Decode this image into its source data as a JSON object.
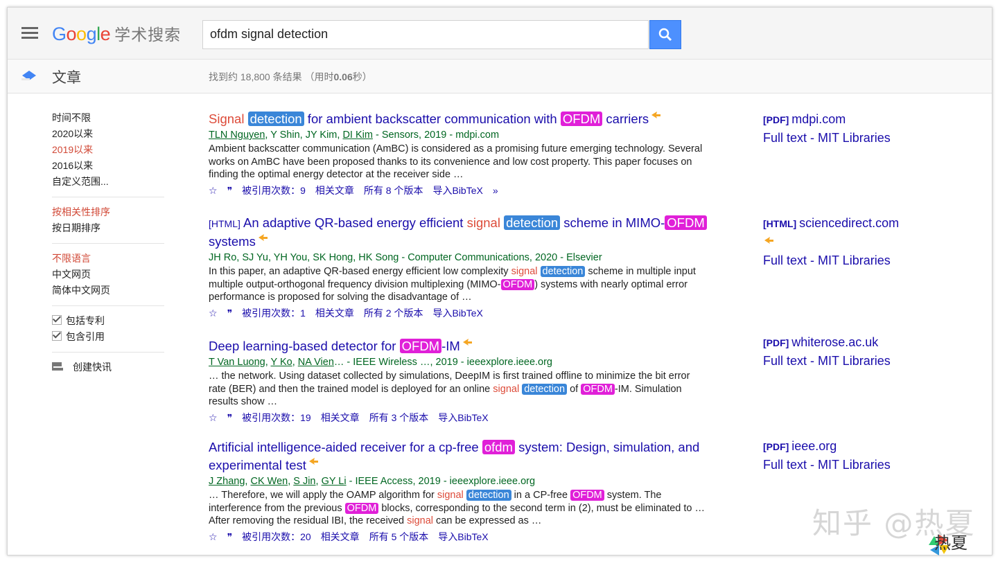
{
  "header": {
    "logo_google": [
      "G",
      "o",
      "o",
      "g",
      "l",
      "e"
    ],
    "logo_suffix": "学术搜索",
    "search_value": "ofdm signal detection"
  },
  "subbar": {
    "section": "文章",
    "stats_prefix": "找到约 18,800 条结果 （用时",
    "stats_time": "0.06",
    "stats_suffix": "秒）"
  },
  "sidebar": {
    "time_filters": [
      "时间不限",
      "2020以来",
      "2019以来",
      "2016以来",
      "自定义范围..."
    ],
    "time_active": "2019以来",
    "sort": [
      "按相关性排序",
      "按日期排序"
    ],
    "lang": [
      "不限语言",
      "中文网页",
      "简体中文网页"
    ],
    "checks": [
      "包括专利",
      "包含引用"
    ],
    "alert": "创建快讯"
  },
  "results": [
    {
      "title_parts": [
        [
          "red",
          "Signal"
        ],
        [
          "plain",
          " "
        ],
        [
          "blue",
          "detection"
        ],
        [
          "plain",
          " for ambient backscatter communication with "
        ],
        [
          "pink",
          "OFDM"
        ],
        [
          "plain",
          " carriers"
        ]
      ],
      "authors_parts": [
        [
          "au",
          "TLN Nguyen"
        ],
        [
          "plain",
          ", Y Shin, JY Kim, "
        ],
        [
          "au",
          "DI Kim"
        ],
        [
          "plain",
          " - Sensors, 2019 - mdpi.com"
        ]
      ],
      "snippet_parts": [
        [
          "plain",
          "Ambient backscatter communication (AmBC) is considered as a promising future emerging technology. Several works on AmBC have been proposed thanks to its convenience and low cost property. This paper focuses on finding the optimal energy detector at the receiver side …"
        ]
      ],
      "cited": "被引用次数：9",
      "related": "相关文章",
      "versions": "所有 8 个版本",
      "bibtex": "导入BibTeX",
      "side": [
        [
          "[PDF]",
          "mdpi.com"
        ],
        [
          "",
          "Full text - MIT Libraries"
        ]
      ]
    },
    {
      "tag": "[HTML]",
      "title_parts": [
        [
          "plain",
          " An adaptive QR-based energy efficient "
        ],
        [
          "red",
          "signal"
        ],
        [
          "plain",
          " "
        ],
        [
          "blue",
          "detection"
        ],
        [
          "plain",
          " scheme in MIMO-"
        ],
        [
          "pink",
          "OFDM"
        ],
        [
          "plain",
          " systems"
        ]
      ],
      "authors_parts": [
        [
          "plain",
          "JH Ro, SJ Yu, YH You, SK Hong, HK Song - Computer Communications, 2020 - Elsevier"
        ]
      ],
      "snippet_parts": [
        [
          "plain",
          "In this paper, an adaptive QR-based energy efficient low complexity "
        ],
        [
          "red",
          "signal"
        ],
        [
          "plain",
          " "
        ],
        [
          "blue",
          "detection"
        ],
        [
          "plain",
          " scheme in multiple input multiple output-orthogonal frequency division multiplexing (MIMO-"
        ],
        [
          "pink",
          "OFDM"
        ],
        [
          "plain",
          ") systems with nearly optimal error performance is proposed for solving the disadvantage of …"
        ]
      ],
      "cited": "被引用次数：1",
      "related": "相关文章",
      "versions": "所有 2 个版本",
      "bibtex": "导入BibTeX",
      "side": [
        [
          "[HTML]",
          "sciencedirect.com"
        ],
        [
          "",
          "Full text - MIT Libraries"
        ]
      ]
    },
    {
      "title_parts": [
        [
          "plain",
          "Deep learning-based detector for "
        ],
        [
          "pink",
          "OFDM"
        ],
        [
          "plain",
          "-IM"
        ]
      ],
      "authors_parts": [
        [
          "au",
          "T Van Luong"
        ],
        [
          "plain",
          ", "
        ],
        [
          "au",
          "Y Ko"
        ],
        [
          "plain",
          ", "
        ],
        [
          "au",
          "NA Vien"
        ],
        [
          "plain",
          "… - IEEE Wireless …, 2019 - ieeexplore.ieee.org"
        ]
      ],
      "snippet_parts": [
        [
          "plain",
          "… the network. Using dataset collected by simulations, DeepIM is first trained offline to minimize the bit error rate (BER) and then the trained model is deployed for an online "
        ],
        [
          "red",
          "signal"
        ],
        [
          "plain",
          " "
        ],
        [
          "blue",
          "detection"
        ],
        [
          "plain",
          " of "
        ],
        [
          "pink",
          "OFDM"
        ],
        [
          "plain",
          "-IM. Simulation results show …"
        ]
      ],
      "cited": "被引用次数：19",
      "related": "相关文章",
      "versions": "所有 3 个版本",
      "bibtex": "导入BibTeX",
      "side": [
        [
          "[PDF]",
          "whiterose.ac.uk"
        ],
        [
          "",
          "Full text - MIT Libraries"
        ]
      ]
    },
    {
      "title_parts": [
        [
          "plain",
          "Artificial intelligence-aided receiver for a cp-free "
        ],
        [
          "pink",
          "ofdm"
        ],
        [
          "plain",
          " system: Design, simulation, and experimental test"
        ]
      ],
      "authors_parts": [
        [
          "au",
          "J Zhang"
        ],
        [
          "plain",
          ", "
        ],
        [
          "au",
          "CK Wen"
        ],
        [
          "plain",
          ", "
        ],
        [
          "au",
          "S Jin"
        ],
        [
          "plain",
          ", "
        ],
        [
          "au",
          "GY Li"
        ],
        [
          "plain",
          " - IEEE Access, 2019 - ieeexplore.ieee.org"
        ]
      ],
      "snippet_parts": [
        [
          "plain",
          "… Therefore, we will apply the OAMP algorithm for "
        ],
        [
          "red",
          "signal"
        ],
        [
          "plain",
          " "
        ],
        [
          "blue",
          "detection"
        ],
        [
          "plain",
          " in a CP-free "
        ],
        [
          "pink",
          "OFDM"
        ],
        [
          "plain",
          " system. The interference from the previous "
        ],
        [
          "pink",
          "OFDM"
        ],
        [
          "plain",
          " blocks, corresponding to the second term in (2), must be eliminated to … After removing the residual IBI, the received "
        ],
        [
          "red",
          "signal"
        ],
        [
          "plain",
          " can be expressed as …"
        ]
      ],
      "cited": "被引用次数：20",
      "related": "相关文章",
      "versions": "所有 5 个版本",
      "bibtex": "导入BibTeX",
      "side": [
        [
          "[PDF]",
          "ieee.org"
        ],
        [
          "",
          "Full text - MIT Libraries"
        ]
      ]
    }
  ],
  "watermark": "知乎 @热夏",
  "corner_mark": "热夏",
  "colors": {
    "link": "#1a0dab",
    "green": "#006621",
    "highlight_blue": "#3a86d8",
    "highlight_pink": "#e020d8",
    "red": "#dd4b39",
    "search_btn": "#4d90fe"
  }
}
